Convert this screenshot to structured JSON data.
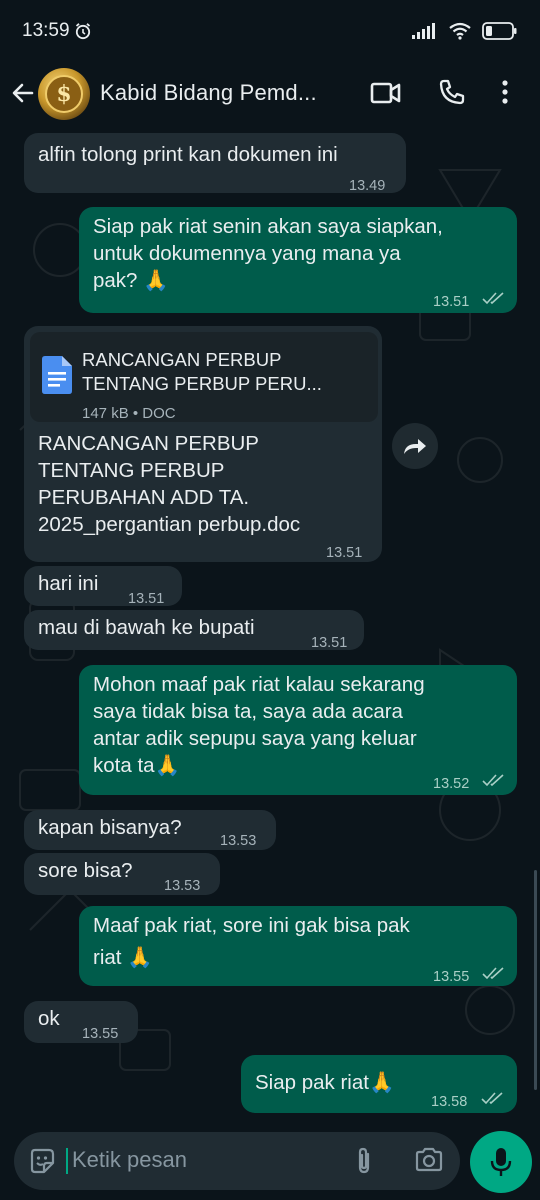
{
  "status_bar": {
    "time": "13:59"
  },
  "header": {
    "contact_name": "Kabid Bidang Pemd...",
    "avatar_glyph": "$"
  },
  "messages": [
    {
      "direction": "in",
      "text_lines": [
        "alfin tolong print kan dokumen ini"
      ],
      "time": "13.49"
    },
    {
      "direction": "out",
      "text_lines": [
        "Siap pak riat senin akan saya siapkan,",
        "untuk dokumennya yang mana ya",
        "pak? 🙏"
      ],
      "time": "13.51"
    },
    {
      "direction": "in",
      "document": {
        "title_lines": [
          "RANCANGAN PERBUP",
          "TENTANG PERBUP PERU..."
        ],
        "meta": "147 kB • DOC"
      },
      "text_lines": [
        "RANCANGAN PERBUP",
        "TENTANG PERBUP",
        "PERUBAHAN ADD TA.",
        "2025_pergantian perbup.doc"
      ],
      "time": "13.51"
    },
    {
      "direction": "in",
      "text_lines": [
        "hari ini"
      ],
      "time": "13.51"
    },
    {
      "direction": "in",
      "text_lines": [
        "mau di bawah ke bupati"
      ],
      "time": "13.51"
    },
    {
      "direction": "out",
      "text_lines": [
        "Mohon maaf pak riat kalau sekarang",
        "saya tidak bisa ta, saya ada acara",
        "antar adik sepupu saya yang keluar",
        "kota ta🙏"
      ],
      "time": "13.52"
    },
    {
      "direction": "in",
      "text_lines": [
        "kapan bisanya?"
      ],
      "time": "13.53"
    },
    {
      "direction": "in",
      "text_lines": [
        "sore bisa?"
      ],
      "time": "13.53"
    },
    {
      "direction": "out",
      "text_lines": [
        "Maaf pak riat, sore ini gak bisa pak",
        "riat 🙏"
      ],
      "time": "13.55"
    },
    {
      "direction": "in",
      "text_lines": [
        "ok"
      ],
      "time": "13.55"
    },
    {
      "direction": "out",
      "text_lines": [
        "Siap pak riat🙏"
      ],
      "time": "13.58"
    }
  ],
  "input": {
    "placeholder": "Ketik pesan"
  },
  "colors": {
    "incoming_bubble": "#202c33",
    "outgoing_bubble": "#005c4b",
    "accent": "#00a884",
    "background": "#0b141a"
  },
  "icons": [
    "back-arrow-icon",
    "video-call-icon",
    "phone-icon",
    "more-options-icon",
    "document-icon",
    "forward-icon",
    "emoji-icon",
    "attach-icon",
    "camera-icon",
    "mic-icon"
  ]
}
